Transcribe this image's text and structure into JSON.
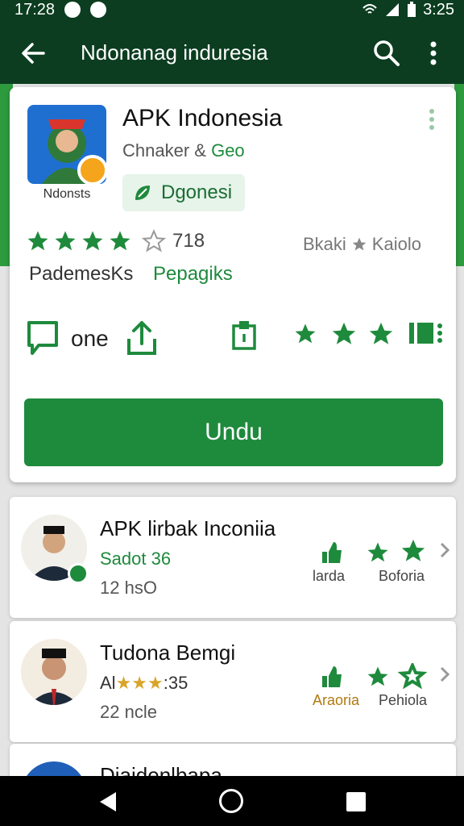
{
  "status_bar": {
    "time_left": "17:28",
    "time_right": "3:25"
  },
  "app_bar": {
    "title": "Ndonanag induresia"
  },
  "app": {
    "title": "APK Indonesia",
    "developer": "Chnaker &",
    "developer_accent": "Geo",
    "icon_caption": "Ndonsts",
    "tag": "Dgonesi",
    "rating_value": "718",
    "rating_stars": 4,
    "rating_note_a": "Bkaki",
    "rating_note_b": "Kaiolo",
    "label_a": "PademesKs",
    "label_b": "Pepagiks",
    "action_label": "one"
  },
  "install_button": {
    "label": "Undu"
  },
  "list": [
    {
      "title": "APK lirbak Inconiia",
      "subtitle": "Sadot 36",
      "meta": "12 hsO",
      "action_a": "larda",
      "action_b": "Boforia"
    },
    {
      "title": "Tudona Bemgi",
      "subtitle": "Al",
      "subtitle_stars": "★★★",
      "subtitle_tail": ":35",
      "meta": "22 ncle",
      "action_a": "Araoria",
      "action_b": "Pehiola"
    },
    {
      "title": "Diaidenlbapa"
    }
  ],
  "colors": {
    "primary": "#1e8a3c",
    "app_bar": "#0c3d20",
    "star": "#1e8a3c"
  }
}
